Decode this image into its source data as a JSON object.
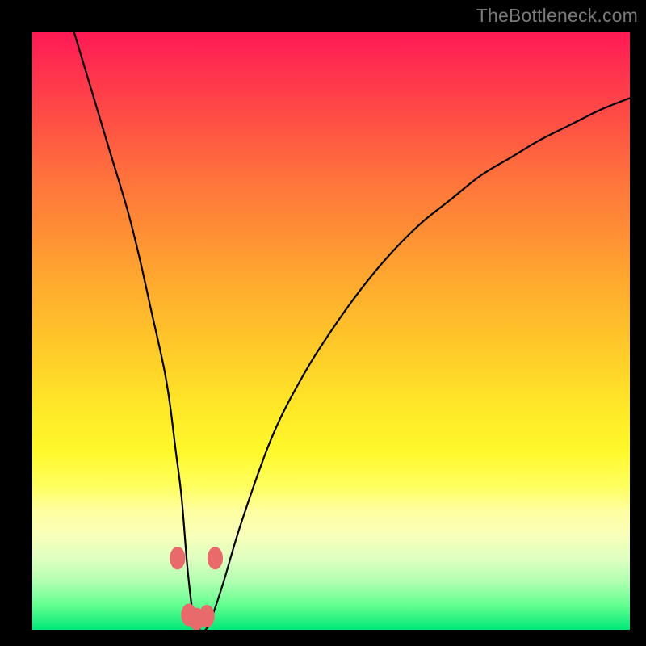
{
  "watermark": "TheBottleneck.com",
  "colors": {
    "curve_stroke": "#000000",
    "marker_fill": "#e86a6a",
    "marker_stroke": "#e86a6a",
    "frame_bg": "#000000",
    "gradient_top": "#ff1a55",
    "gradient_bottom": "#00e878"
  },
  "chart_data": {
    "type": "line",
    "title": "",
    "xlabel": "",
    "ylabel": "",
    "xlim": [
      0,
      100
    ],
    "ylim": [
      0,
      100
    ],
    "grid": false,
    "legend": false,
    "series": [
      {
        "name": "curve",
        "x": [
          7,
          10,
          13,
          16,
          18,
          20,
          22,
          23,
          24,
          25,
          26,
          27,
          28,
          29,
          30,
          32,
          35,
          40,
          45,
          50,
          55,
          60,
          65,
          70,
          75,
          80,
          85,
          90,
          95,
          100
        ],
        "values": [
          100,
          90,
          80,
          70,
          62,
          53,
          44,
          38,
          30,
          22,
          10,
          2,
          0,
          0,
          2,
          8,
          18,
          32,
          42,
          50,
          57,
          63,
          68,
          72,
          76,
          79,
          82,
          84.5,
          87,
          89
        ]
      }
    ],
    "markers": {
      "x": [
        24.3,
        26.2,
        27.5,
        29.2,
        30.6
      ],
      "values": [
        12,
        2.5,
        1.8,
        2.3,
        12
      ],
      "rx": 1.3,
      "ry": 1.9
    }
  }
}
